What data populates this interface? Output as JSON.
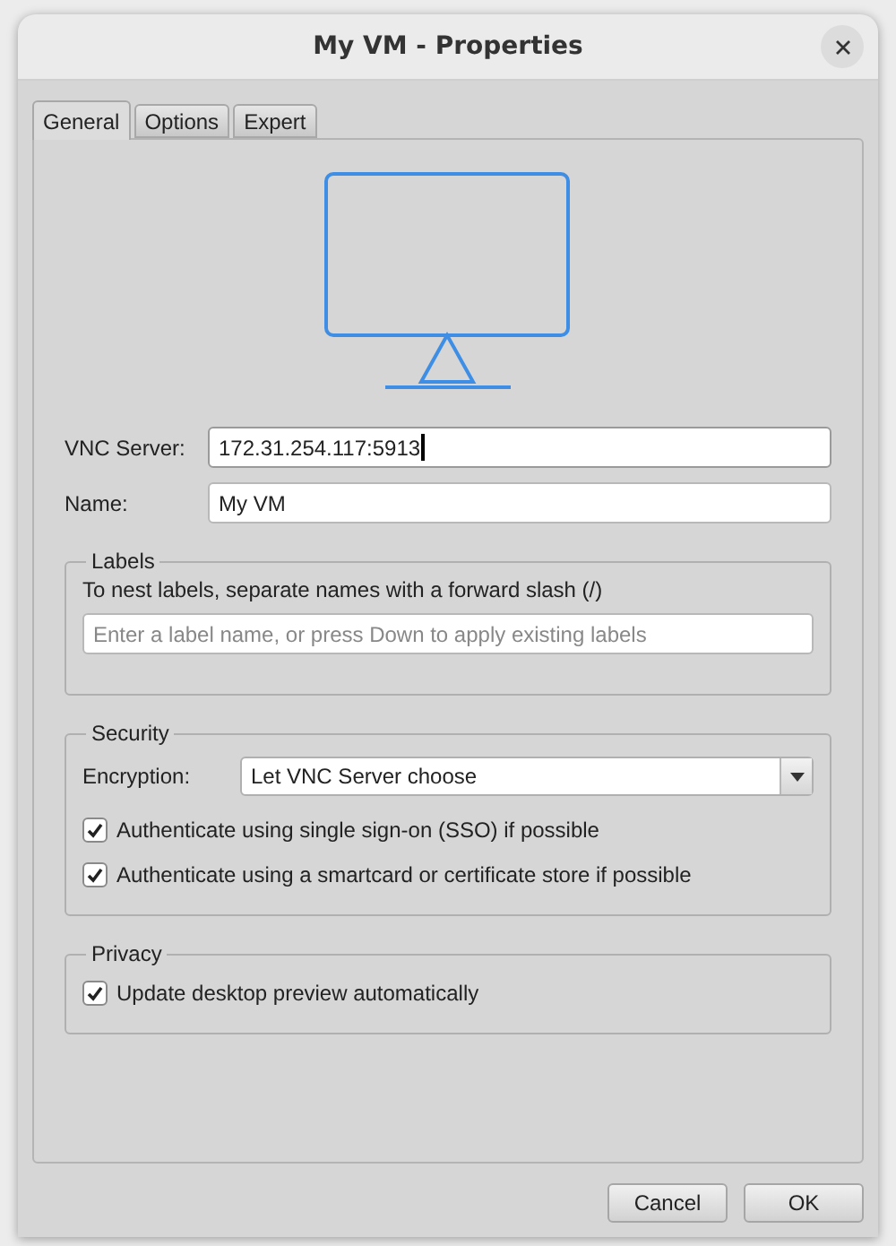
{
  "window": {
    "title": "My VM - Properties"
  },
  "tabs": [
    {
      "label": "General",
      "selected": true
    },
    {
      "label": "Options",
      "selected": false
    },
    {
      "label": "Expert",
      "selected": false
    }
  ],
  "fields": [
    {
      "label": "VNC Server:",
      "value": "172.31.254.117:5913",
      "focused": true
    },
    {
      "label": "Name:",
      "value": "My VM",
      "focused": false
    }
  ],
  "labels_group": {
    "title": "Labels",
    "hint": "To nest labels, separate names with a forward slash (/)",
    "placeholder": "Enter a label name, or press Down to apply existing labels"
  },
  "security_group": {
    "title": "Security",
    "encryption_label": "Encryption:",
    "encryption_value": "Let VNC Server choose",
    "options": [
      {
        "label": "Authenticate using single sign-on (SSO) if possible",
        "checked": true
      },
      {
        "label": "Authenticate using a smartcard or certificate store if possible",
        "checked": true
      }
    ]
  },
  "privacy_group": {
    "title": "Privacy",
    "options": [
      {
        "label": "Update desktop preview automatically",
        "checked": true
      }
    ]
  },
  "buttons": [
    "Cancel",
    "OK"
  ]
}
